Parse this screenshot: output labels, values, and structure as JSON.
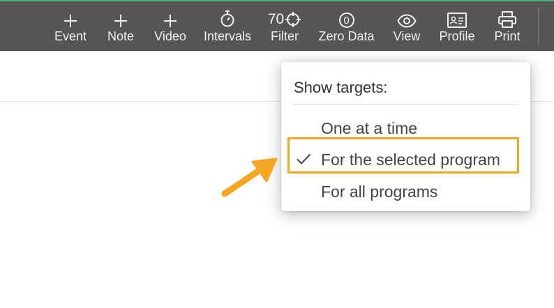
{
  "toolbar": {
    "items": [
      {
        "label": "Event",
        "icon": "plus-icon"
      },
      {
        "label": "Note",
        "icon": "plus-icon"
      },
      {
        "label": "Video",
        "icon": "plus-icon"
      },
      {
        "label": "Intervals",
        "icon": "stopwatch-icon"
      },
      {
        "label": "Filter",
        "icon": "crosshair-icon",
        "value": "70"
      },
      {
        "label": "Zero Data",
        "icon": "zero-circle-icon",
        "glyph": "0"
      },
      {
        "label": "View",
        "icon": "eye-icon"
      },
      {
        "label": "Profile",
        "icon": "id-card-icon"
      },
      {
        "label": "Print",
        "icon": "printer-icon"
      }
    ]
  },
  "dropdown": {
    "title": "Show targets:",
    "options": [
      {
        "label": "One at a time",
        "checked": false
      },
      {
        "label": "For the selected program",
        "checked": true
      },
      {
        "label": "For all programs",
        "checked": false
      }
    ]
  },
  "colors": {
    "toolbar_bg": "#555555",
    "accent_top": "#4caf7d",
    "highlight": "#f5a623"
  }
}
